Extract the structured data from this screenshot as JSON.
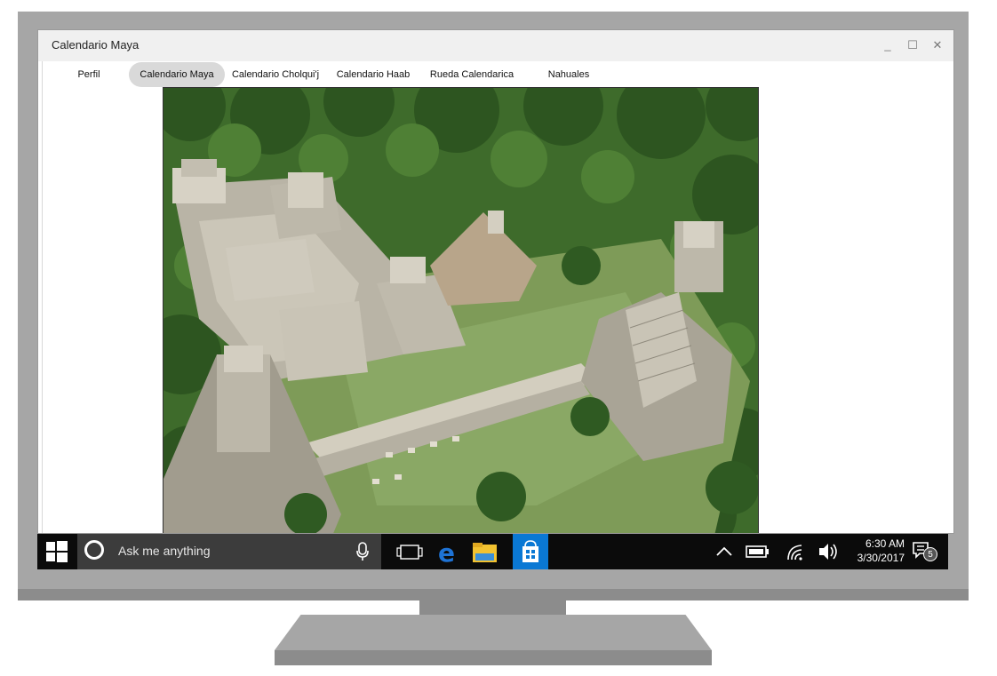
{
  "window": {
    "title": "Calendario Maya",
    "minimize_glyph": "_",
    "maximize_glyph": "☐",
    "close_glyph": "✕"
  },
  "tabs": [
    {
      "label": "Perfil",
      "active": false
    },
    {
      "label": "Calendario Maya",
      "active": true
    },
    {
      "label": "Calendario Cholqui'j",
      "active": false
    },
    {
      "label": "Calendario Haab",
      "active": false
    },
    {
      "label": "Rueda Calendarica",
      "active": false
    },
    {
      "label": "Nahuales",
      "active": false
    }
  ],
  "main": {
    "image_icon": "maya-ruins-aerial-photo"
  },
  "taskbar": {
    "search_placeholder": "Ask me anything",
    "time": "6:30 AM",
    "date": "3/30/2017",
    "notification_count": "5",
    "icons": [
      "windows-start-icon",
      "cortana-icon",
      "microphone-icon",
      "task-view-icon",
      "edge-icon",
      "file-explorer-icon",
      "store-icon",
      "chevron-up-icon",
      "battery-icon",
      "wifi-icon",
      "volume-icon",
      "notification-icon"
    ]
  },
  "colors": {
    "taskbar": "#0b0b0b",
    "search_box": "#3c3c3c",
    "store_accent": "#0a78d4",
    "edge_blue": "#1e73d6",
    "folder_yellow": "#f2c230",
    "active_tab": "#d9d9d9",
    "bezel": "#a6a6a6"
  }
}
